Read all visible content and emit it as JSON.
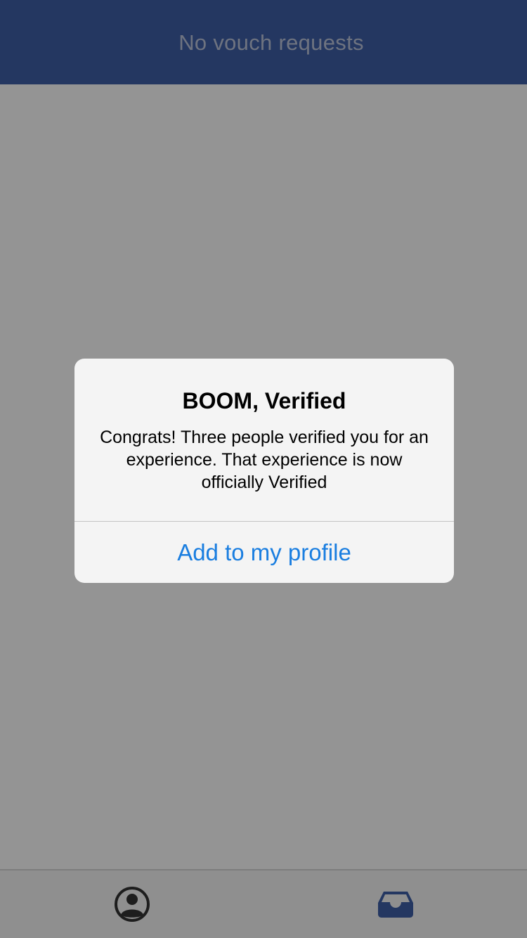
{
  "header": {
    "title": "No vouch requests"
  },
  "tabbar": {
    "tabs": [
      {
        "icon": "profile-icon",
        "active": false
      },
      {
        "icon": "inbox-icon",
        "active": true
      }
    ]
  },
  "alert": {
    "title": "BOOM, Verified",
    "message": "Congrats! Three people verified you for an experience. That experience is now officially Verified",
    "action_label": "Add to my profile"
  },
  "colors": {
    "header_bg": "#3e5fa8",
    "header_text": "#bdc6dc",
    "accent": "#1a7ee0",
    "tab_active": "#3e5fa8",
    "tab_inactive": "#333333",
    "overlay": "rgba(0,0,0,0.42)"
  }
}
